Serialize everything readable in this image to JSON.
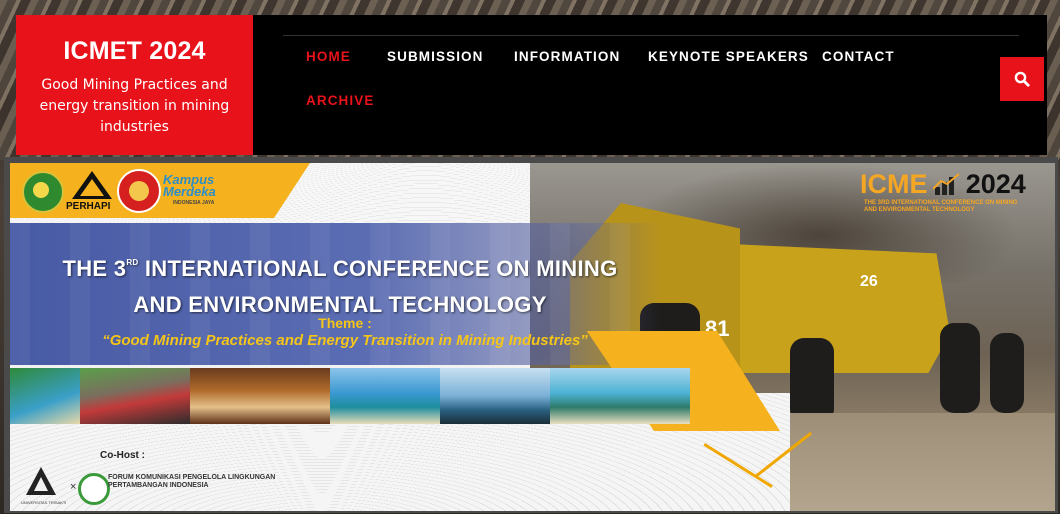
{
  "brand": {
    "title": "ICMET 2024",
    "subtitle": "Good Mining Practices and energy transition in mining industries"
  },
  "nav": {
    "items": [
      {
        "label": "HOME",
        "active": true
      },
      {
        "label": "SUBMISSION",
        "active": false
      },
      {
        "label": "INFORMATION",
        "active": false
      },
      {
        "label": "KEYNOTE SPEAKERS",
        "active": false
      },
      {
        "label": "CONTACT",
        "active": false
      },
      {
        "label": "ARCHIVE",
        "active": false
      }
    ],
    "search_icon": "search-icon"
  },
  "banner": {
    "partner_logos": {
      "perhapi": "PERHAPI",
      "kampus_line1": "Kampus",
      "kampus_line2": "Merdeka",
      "kampus_tag": "INDONESIA JAYA"
    },
    "icmet_logo": {
      "text": "ICME",
      "year": "2024",
      "tagline_line1": "THE 3RD INTERNATIONAL CONFERENCE ON MINING",
      "tagline_line2": "AND ENVIRONMENTAL TECHNOLOGY"
    },
    "title_part1": "THE 3",
    "title_sup": "RD",
    "title_part2": " INTERNATIONAL CONFERENCE ON MINING",
    "title_line2": "AND ENVIRONMENTAL TECHNOLOGY",
    "theme_label": "Theme :",
    "theme_text": "“Good Mining Practices and Energy Transition in Mining Industries”",
    "cohost_label": "Co-Host :",
    "cohost_cross": "×",
    "cohost_univ": "UNIVERSITAS TRISAKTI",
    "cohost_forum": "FORUM KOMUNIKASI PENGELOLA LINGKUNGAN PERTAMBANGAN INDONESIA",
    "truck_number": "81",
    "truck_number_2": "26"
  },
  "colors": {
    "accent_red": "#e8121a",
    "nav_bg": "#000000",
    "banner_yellow": "#f5b21e",
    "banner_blue": "#3e52a0"
  }
}
